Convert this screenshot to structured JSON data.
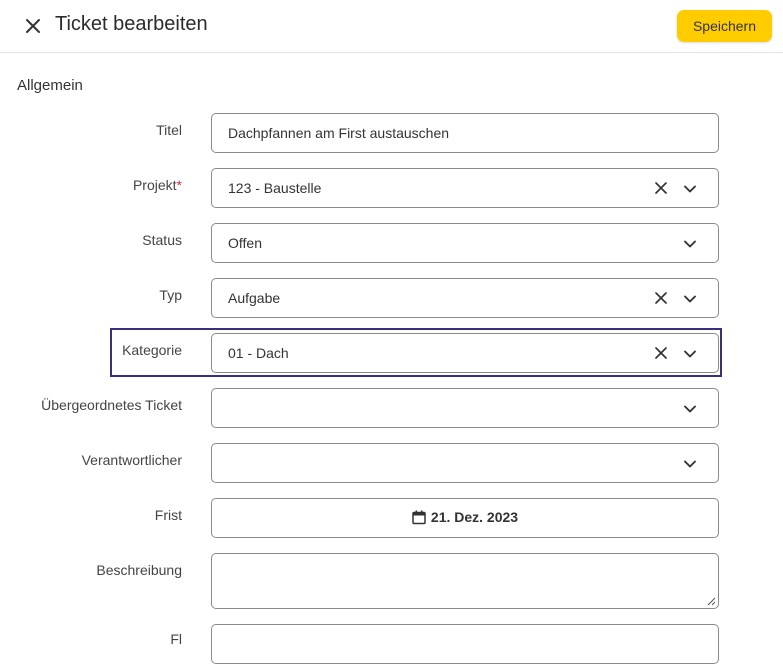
{
  "header": {
    "title": "Ticket bearbeiten",
    "save_label": "Speichern",
    "close_icon": "close-icon"
  },
  "colors": {
    "accent": "#ffcc00",
    "highlight_border": "#3b2f7a",
    "required": "#d32f2f"
  },
  "section": {
    "title": "Allgemein"
  },
  "fields": {
    "titel": {
      "label": "Titel",
      "value": "Dachpfannen am First austauschen"
    },
    "projekt": {
      "label": "Projekt",
      "required_mark": "*",
      "value": "123 - Baustelle"
    },
    "status": {
      "label": "Status",
      "value": "Offen"
    },
    "typ": {
      "label": "Typ",
      "value": "Aufgabe"
    },
    "kategorie": {
      "label": "Kategorie",
      "value": "01 - Dach"
    },
    "uebergeordnet": {
      "label": "Übergeordnetes Ticket",
      "value": ""
    },
    "verantwortlicher": {
      "label": "Verantwortlicher",
      "value": ""
    },
    "frist": {
      "label": "Frist",
      "value": "21. Dez. 2023",
      "icon": "calendar-icon"
    },
    "beschreibung": {
      "label": "Beschreibung",
      "value": ""
    },
    "next": {
      "label": "Fl"
    }
  }
}
